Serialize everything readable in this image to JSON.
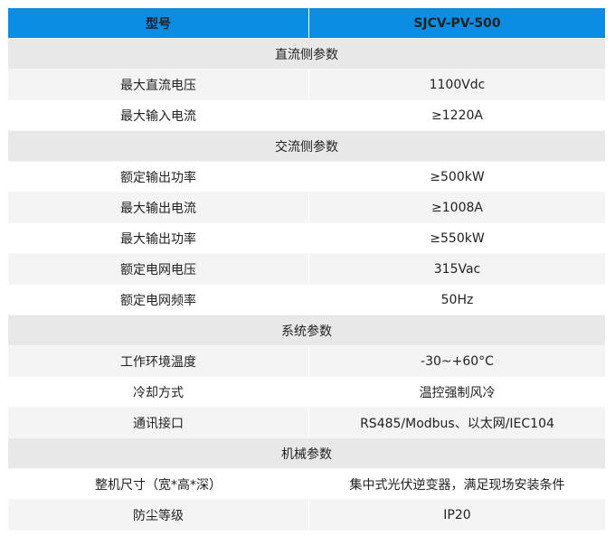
{
  "header": {
    "col1": "型号",
    "col2": "SJCV-PV-500"
  },
  "sections": [
    {
      "title": "直流侧参数",
      "rows": [
        {
          "label": "最大直流电压",
          "value": "1100Vdc"
        },
        {
          "label": "最大输入电流",
          "value": "≥1220A"
        }
      ]
    },
    {
      "title": "交流侧参数",
      "rows": [
        {
          "label": "额定输出功率",
          "value": "≥500kW"
        },
        {
          "label": "最大输出电流",
          "value": "≥1008A"
        },
        {
          "label": "最大输出功率",
          "value": "≥550kW"
        },
        {
          "label": "额定电网电压",
          "value": "315Vac"
        },
        {
          "label": "额定电网频率",
          "value": "50Hz"
        }
      ]
    },
    {
      "title": "系统参数",
      "rows": [
        {
          "label": "工作环境温度",
          "value": "-30~+60°C"
        },
        {
          "label": "冷却方式",
          "value": "温控强制风冷"
        },
        {
          "label": "通讯接口",
          "value": "RS485/Modbus、以太网/IEC104"
        }
      ]
    },
    {
      "title": "机械参数",
      "rows": [
        {
          "label": "整机尺寸（宽*高*深）",
          "value": "集中式光伏逆变器，满足现场安装条件"
        },
        {
          "label": "防尘等级",
          "value": "IP20"
        }
      ]
    }
  ],
  "colors": {
    "header_bg": "#0b8de3",
    "section_bg": "#e8e8e8",
    "row_alt_bg": "#f4f4f4"
  }
}
